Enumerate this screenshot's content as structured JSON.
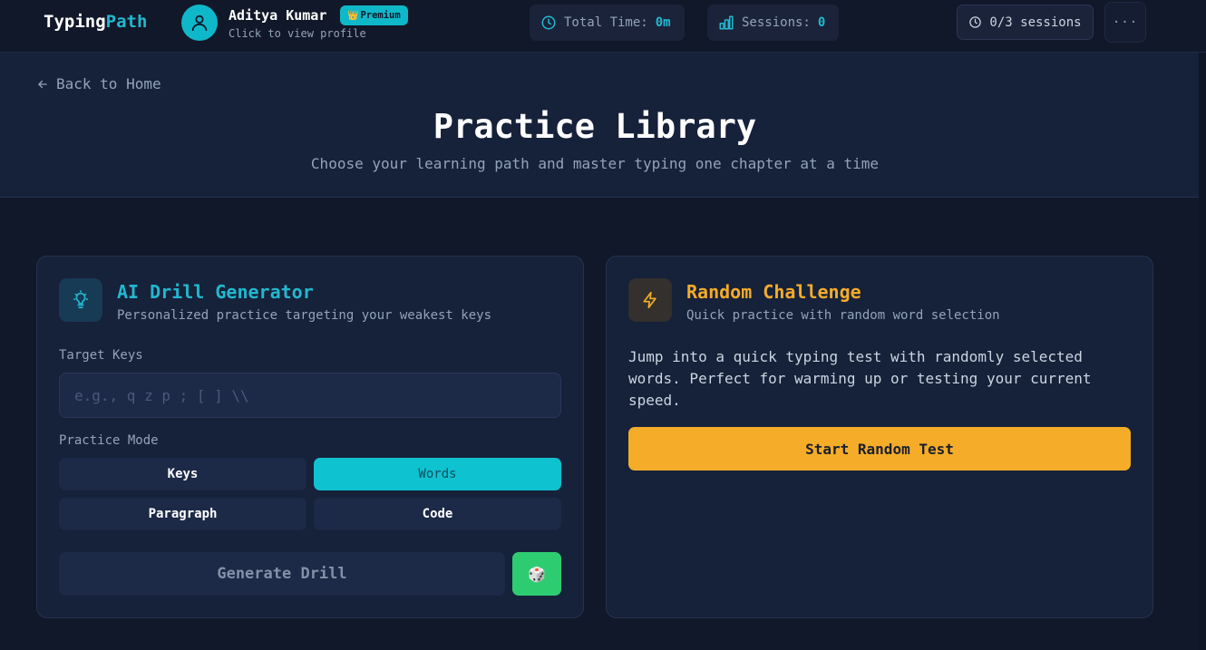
{
  "header": {
    "logo_primary": "Typing",
    "logo_accent": "Path",
    "user": {
      "name": "Aditya Kumar",
      "badge": "Premium",
      "subtitle": "Click to view profile"
    },
    "stats": {
      "total_time_label": "Total Time:",
      "total_time_value": "0m",
      "sessions_label": "Sessions:",
      "sessions_value": "0"
    },
    "sessions_button": "0/3 sessions",
    "more_button": "···"
  },
  "hero": {
    "back_link": "Back to Home",
    "title": "Practice Library",
    "subtitle": "Choose your learning path and master typing one chapter at a time"
  },
  "drill_card": {
    "title": "AI Drill Generator",
    "subtitle": "Personalized practice targeting your weakest keys",
    "target_keys_label": "Target Keys",
    "target_keys_placeholder": "e.g., q z p ; [ ] \\\\",
    "target_keys_value": "",
    "practice_mode_label": "Practice Mode",
    "modes": [
      {
        "label": "Keys",
        "active": false
      },
      {
        "label": "Words",
        "active": true
      },
      {
        "label": "Paragraph",
        "active": false
      },
      {
        "label": "Code",
        "active": false
      }
    ],
    "generate_button": "Generate Drill",
    "random_button_icon": "🎲"
  },
  "random_card": {
    "title": "Random Challenge",
    "subtitle": "Quick practice with random word selection",
    "description": "Jump into a quick typing test with randomly selected words. Perfect for warming up or testing your current speed.",
    "start_button": "Start Random Test"
  },
  "colors": {
    "background": "#111829",
    "panel": "#16213a",
    "accent_cyan": "#22b8cf",
    "accent_orange": "#f5ac28",
    "accent_green": "#2ecc71"
  },
  "icons": {
    "avatar": "user-icon",
    "total_time": "clock-icon",
    "sessions": "bar-chart-icon",
    "sessions_button": "clock-icon",
    "back": "arrow-left-icon",
    "drill": "lightbulb-icon",
    "random": "lightning-icon",
    "dice": "dice-icon"
  }
}
